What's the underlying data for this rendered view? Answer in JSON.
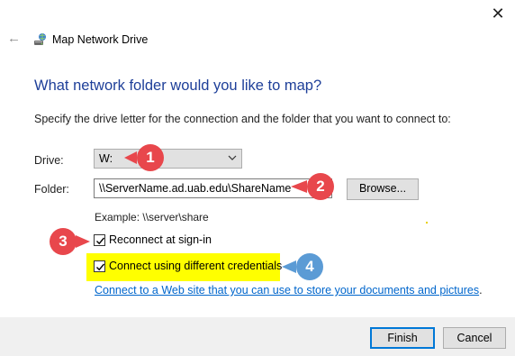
{
  "window": {
    "title": "Map Network Drive",
    "app_icon": "network-drive-icon",
    "back_icon": "back-arrow-icon",
    "close_icon": "close-icon"
  },
  "main": {
    "heading": "What network folder would you like to map?",
    "instruction": "Specify the drive letter for the connection and the folder that you want to connect to:",
    "drive_label": "Drive:",
    "drive_value": "W:",
    "folder_label": "Folder:",
    "folder_value": "\\\\ServerName.ad.uab.edu\\ShareName",
    "browse_label": "Browse...",
    "example_text": "Example: \\\\server\\share",
    "reconnect_label": "Reconnect at sign-in",
    "reconnect_checked": true,
    "credentials_label": "Connect using different credentials",
    "credentials_checked": true,
    "link_text": "Connect to a Web site that you can use to store your documents and pictures",
    "link_period": "."
  },
  "footer": {
    "finish_label": "Finish",
    "cancel_label": "Cancel"
  },
  "annotations": {
    "callout_1": "1",
    "callout_2": "2",
    "callout_3": "3",
    "callout_4": "4",
    "red_color": "#e8474c",
    "blue_color": "#5b9bd5",
    "highlight_color": "#ffff00"
  }
}
